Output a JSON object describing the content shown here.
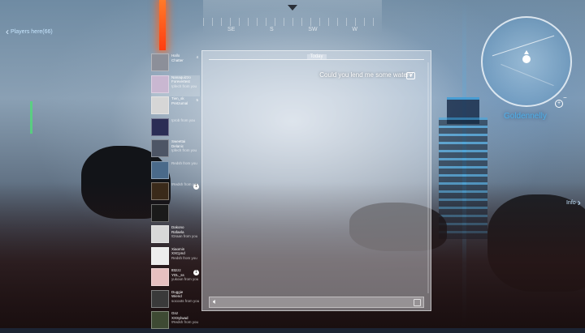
{
  "hud": {
    "players_link": "Players here(66)",
    "info_link": "Info",
    "location_name": "Goldennelly"
  },
  "compass": {
    "labels": [
      "SE",
      "S",
      "SW",
      "W"
    ]
  },
  "contacts": [
    {
      "name": "Hallo",
      "sub": "Chatter",
      "msg": "",
      "num": "4",
      "avatar_color": "#8c8f99"
    },
    {
      "name": "Nanaquizzo",
      "sub": "Forevertest",
      "msg": "!pfech from you",
      "num": "",
      "avatar_color": "#c9b7d1",
      "active": true
    },
    {
      "name": "Tien_sk",
      "sub": "Pretzumal",
      "msg": "",
      "num": "5",
      "avatar_color": "#d6d6d6"
    },
    {
      "name": "",
      "sub": "",
      "msg": "!prob from you",
      "num": "",
      "avatar_color": "#2b2d55"
    },
    {
      "name": "Sweettai",
      "sub": "Delanic",
      "msg": "!pfech from you",
      "num": "",
      "avatar_color": "#4d5565"
    },
    {
      "name": "",
      "sub": "",
      "msg": "Redsh from you",
      "num": "",
      "avatar_color": "#4a6a8a"
    },
    {
      "name": "",
      "sub": "",
      "msg": "!Redsh from you",
      "num": "",
      "avatar_color": "#3a2a1a",
      "badge": "1"
    },
    {
      "name": "",
      "sub": "",
      "msg": "",
      "num": "",
      "avatar_color": "#1a1a1a"
    },
    {
      "name": "Dakono",
      "sub": "Rafaela",
      "msg": "!Draan from you",
      "num": "",
      "avatar_color": "#d8d8d8"
    },
    {
      "name": "Xiaomin",
      "sub": "XXCpnd",
      "msg": "Redsh from you",
      "num": "",
      "avatar_color": "#ededed"
    },
    {
      "name": "ttttzzz",
      "sub": "YDL_ss",
      "msg": "yukoun from you",
      "num": "",
      "avatar_color": "#e6c0c0",
      "badge": "1"
    },
    {
      "name": "Duggie",
      "sub": "Wiend",
      "msg": "socoots from you",
      "num": "",
      "avatar_color": "#3a3a3a"
    },
    {
      "name": "Gnz",
      "sub": "XXSylwad",
      "msg": "!Redsh from you",
      "num": "",
      "avatar_color": "#3e4a33"
    }
  ],
  "chat": {
    "date_label": "Today",
    "messages": [
      {
        "text": "Could you lend me some water?",
        "icon": "game-controller-icon"
      }
    ]
  }
}
